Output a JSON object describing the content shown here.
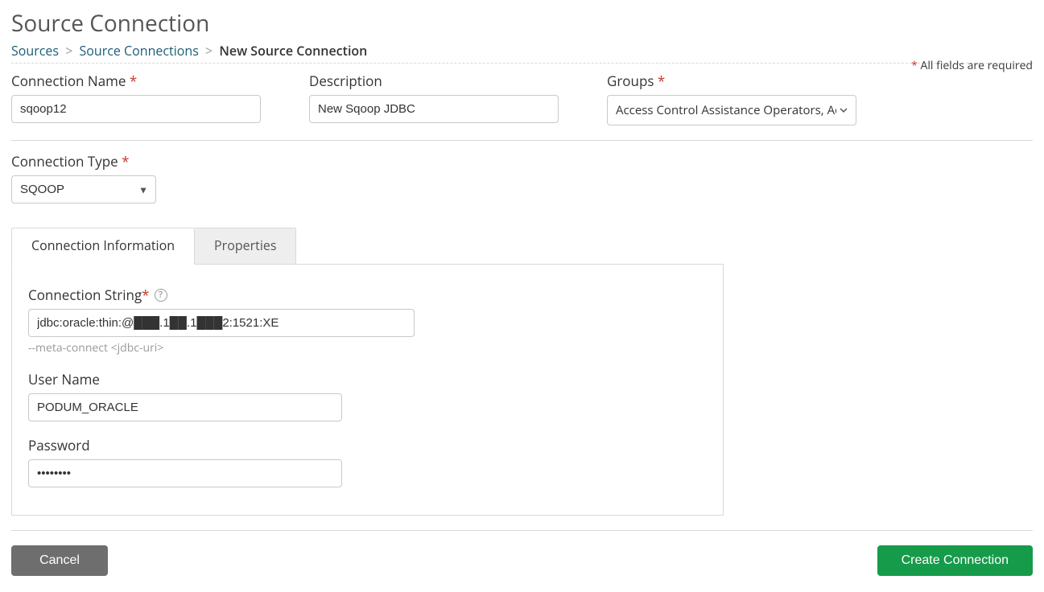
{
  "header": {
    "title": "Source Connection",
    "breadcrumb": {
      "sources": "Sources",
      "connections": "Source Connections",
      "current": "New Source Connection"
    },
    "required_note_prefix": "*",
    "required_note": " All fields are required"
  },
  "fields": {
    "connection_name": {
      "label": "Connection Name",
      "required": true,
      "value": "sqoop12"
    },
    "description": {
      "label": "Description",
      "required": false,
      "value": "New Sqoop JDBC"
    },
    "groups": {
      "label": "Groups",
      "required": true,
      "display": "Access Control Assistance Operators,  Admin"
    },
    "connection_type": {
      "label": "Connection Type",
      "required": true,
      "value": "SQOOP"
    }
  },
  "tabs": {
    "conn_info": "Connection Information",
    "properties": "Properties"
  },
  "conn_info": {
    "connection_string": {
      "label": "Connection String",
      "required": true,
      "value": "jdbc:oracle:thin:@███.1██.1███2:1521:XE",
      "hint": "--meta-connect <jdbc-uri>"
    },
    "username": {
      "label": "User Name",
      "value": "PODUM_ORACLE"
    },
    "password": {
      "label": "Password",
      "value": "••••••••"
    }
  },
  "actions": {
    "cancel": "Cancel",
    "create": "Create Connection"
  },
  "required_marker": " *"
}
